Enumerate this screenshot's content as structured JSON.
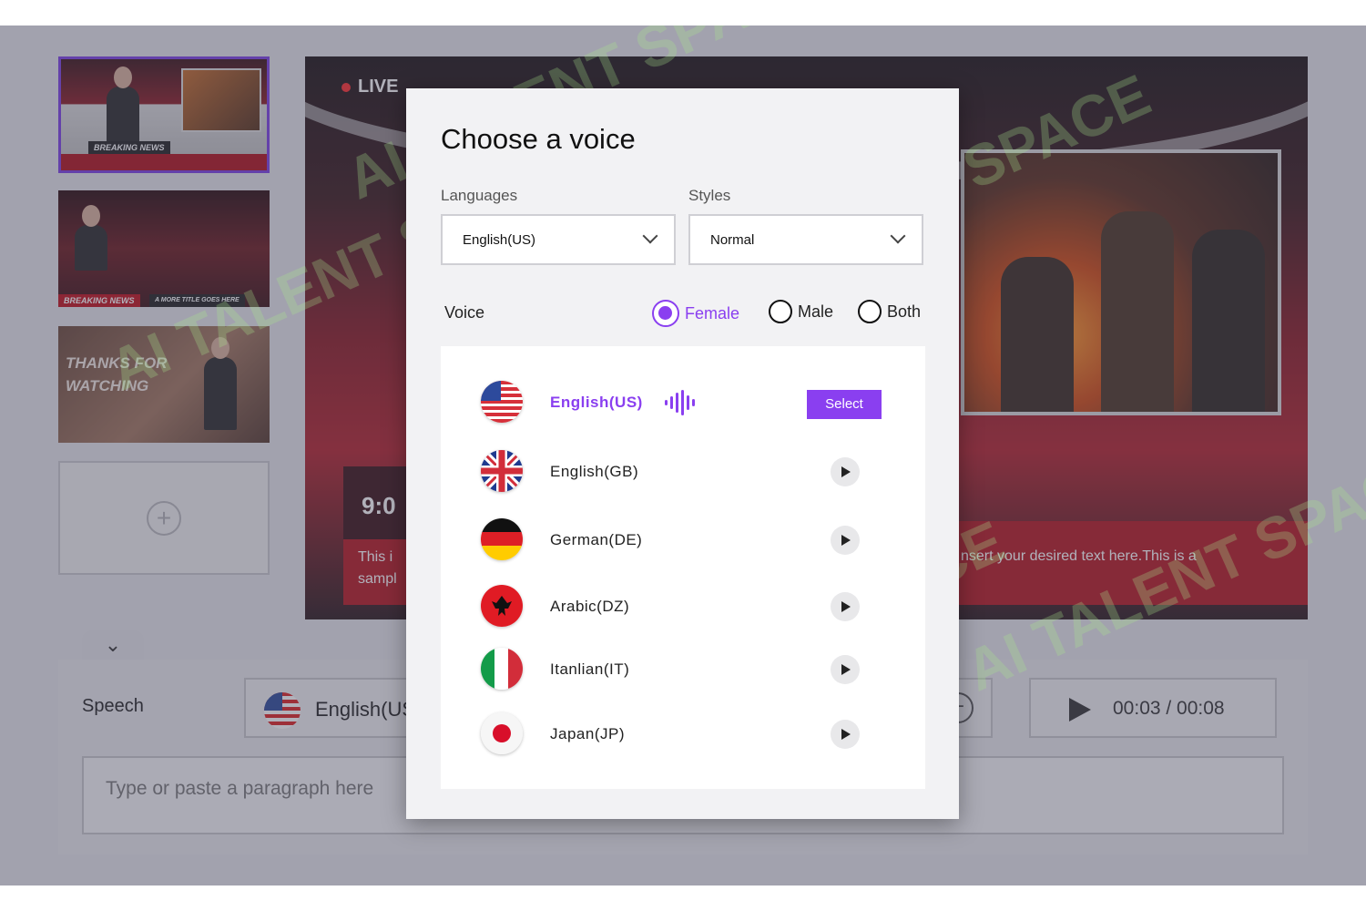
{
  "slides": [
    {
      "banner": "BREAKING NEWS"
    },
    {
      "banner": "BREAKING NEWS",
      "subtitle": "A MORE TITLE GOES HERE"
    },
    {
      "line1": "THANKS FOR",
      "line2": "WATCHING"
    }
  ],
  "preview": {
    "live_label": "LIVE",
    "clock": "9:0",
    "caption_left_line1": "This i",
    "caption_left_line2": "sampl",
    "caption_right": "nsert your desired text here.This is a"
  },
  "speech": {
    "label": "Speech",
    "language": "English(US",
    "time": "00:03 / 00:08",
    "placeholder": "Type or paste a paragraph here"
  },
  "modal": {
    "title": "Choose a voice",
    "languages_label": "Languages",
    "languages_value": "English(US)",
    "styles_label": "Styles",
    "styles_value": "Normal",
    "voice_label": "Voice",
    "radio_female": "Female",
    "radio_male": "Male",
    "radio_both": "Both",
    "select_button": "Select",
    "voices": [
      {
        "name": "English(US)",
        "flag": "us-flag-icon"
      },
      {
        "name": "English(GB)",
        "flag": "uk-flag-icon"
      },
      {
        "name": "German(DE)",
        "flag": "germany-flag-icon"
      },
      {
        "name": "Arabic(DZ)",
        "flag": "albania-flag-icon"
      },
      {
        "name": "Itanlian(IT)",
        "flag": "italy-flag-icon"
      },
      {
        "name": "Japan(JP)",
        "flag": "japan-flag-icon"
      }
    ]
  },
  "watermark": "AI TALENT SPACE",
  "colors": {
    "accent": "#8a3ff0",
    "news_red": "#b51720"
  }
}
